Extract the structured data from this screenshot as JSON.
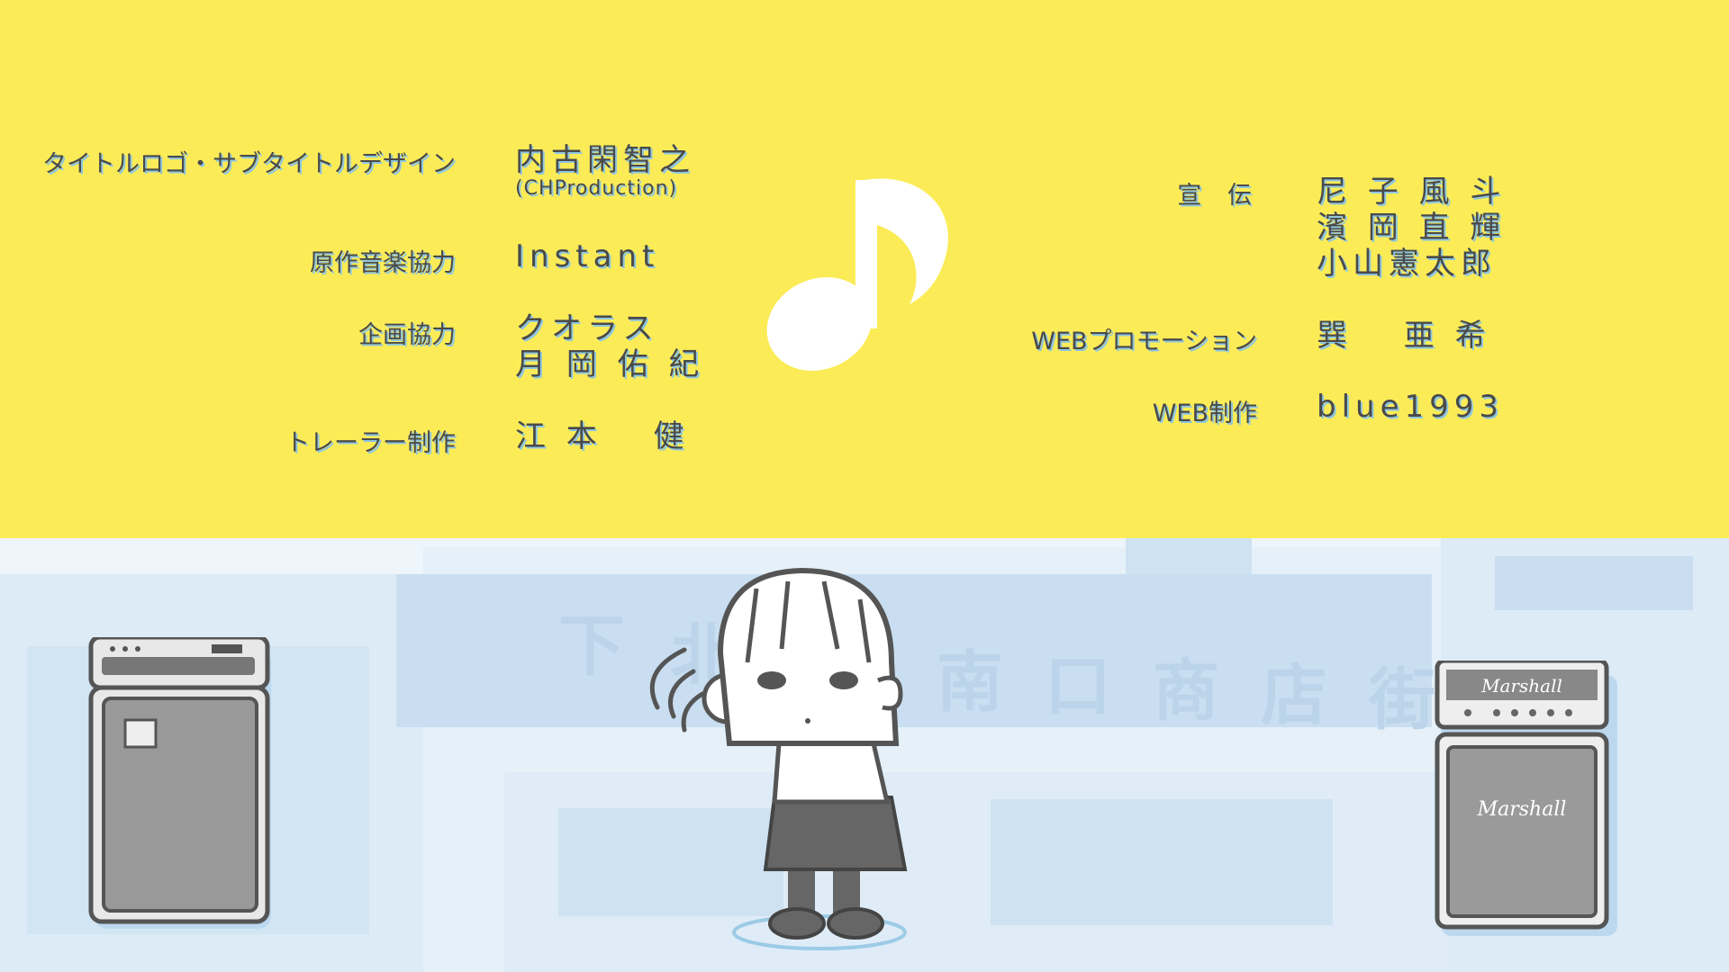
{
  "credits_left": [
    {
      "role": "タイトルロゴ・サブタイトルデザイン",
      "names": [
        "内古閑智之"
      ],
      "sub": "(CHProduction)"
    },
    {
      "role": "原作音楽協力",
      "names": [
        "Instant"
      ]
    },
    {
      "role": "企画協力",
      "names": [
        "クオラス",
        "月 岡 佑 紀"
      ]
    },
    {
      "role": "トレーラー制作",
      "names": [
        "江 本　 健"
      ]
    }
  ],
  "credits_right": [
    {
      "role": "宣 伝",
      "names": [
        "尼 子 風 斗",
        "濱 岡 直 輝",
        "小山憲太郎"
      ]
    },
    {
      "role": "WEBプロモーション",
      "names": [
        "巽　 亜 希"
      ]
    },
    {
      "role": "WEB制作",
      "names": [
        "blue1993"
      ]
    }
  ],
  "background": {
    "sign_text": [
      "下",
      "北",
      "南",
      "口",
      "商",
      "店",
      "街"
    ]
  },
  "amps": {
    "right_brand_top": "Marshall",
    "right_brand_bottom": "Marshall"
  },
  "icons": {
    "music": "music-note-icon"
  },
  "colors": {
    "top_panel": "#fbec57",
    "text": "#4a4a4a",
    "text_shadow": "#8fc7e0",
    "bg_tint": "#dcebf6",
    "bg_sign": "#c7dcef",
    "amp_body": "#9a9a9a",
    "amp_outline": "#555555"
  }
}
